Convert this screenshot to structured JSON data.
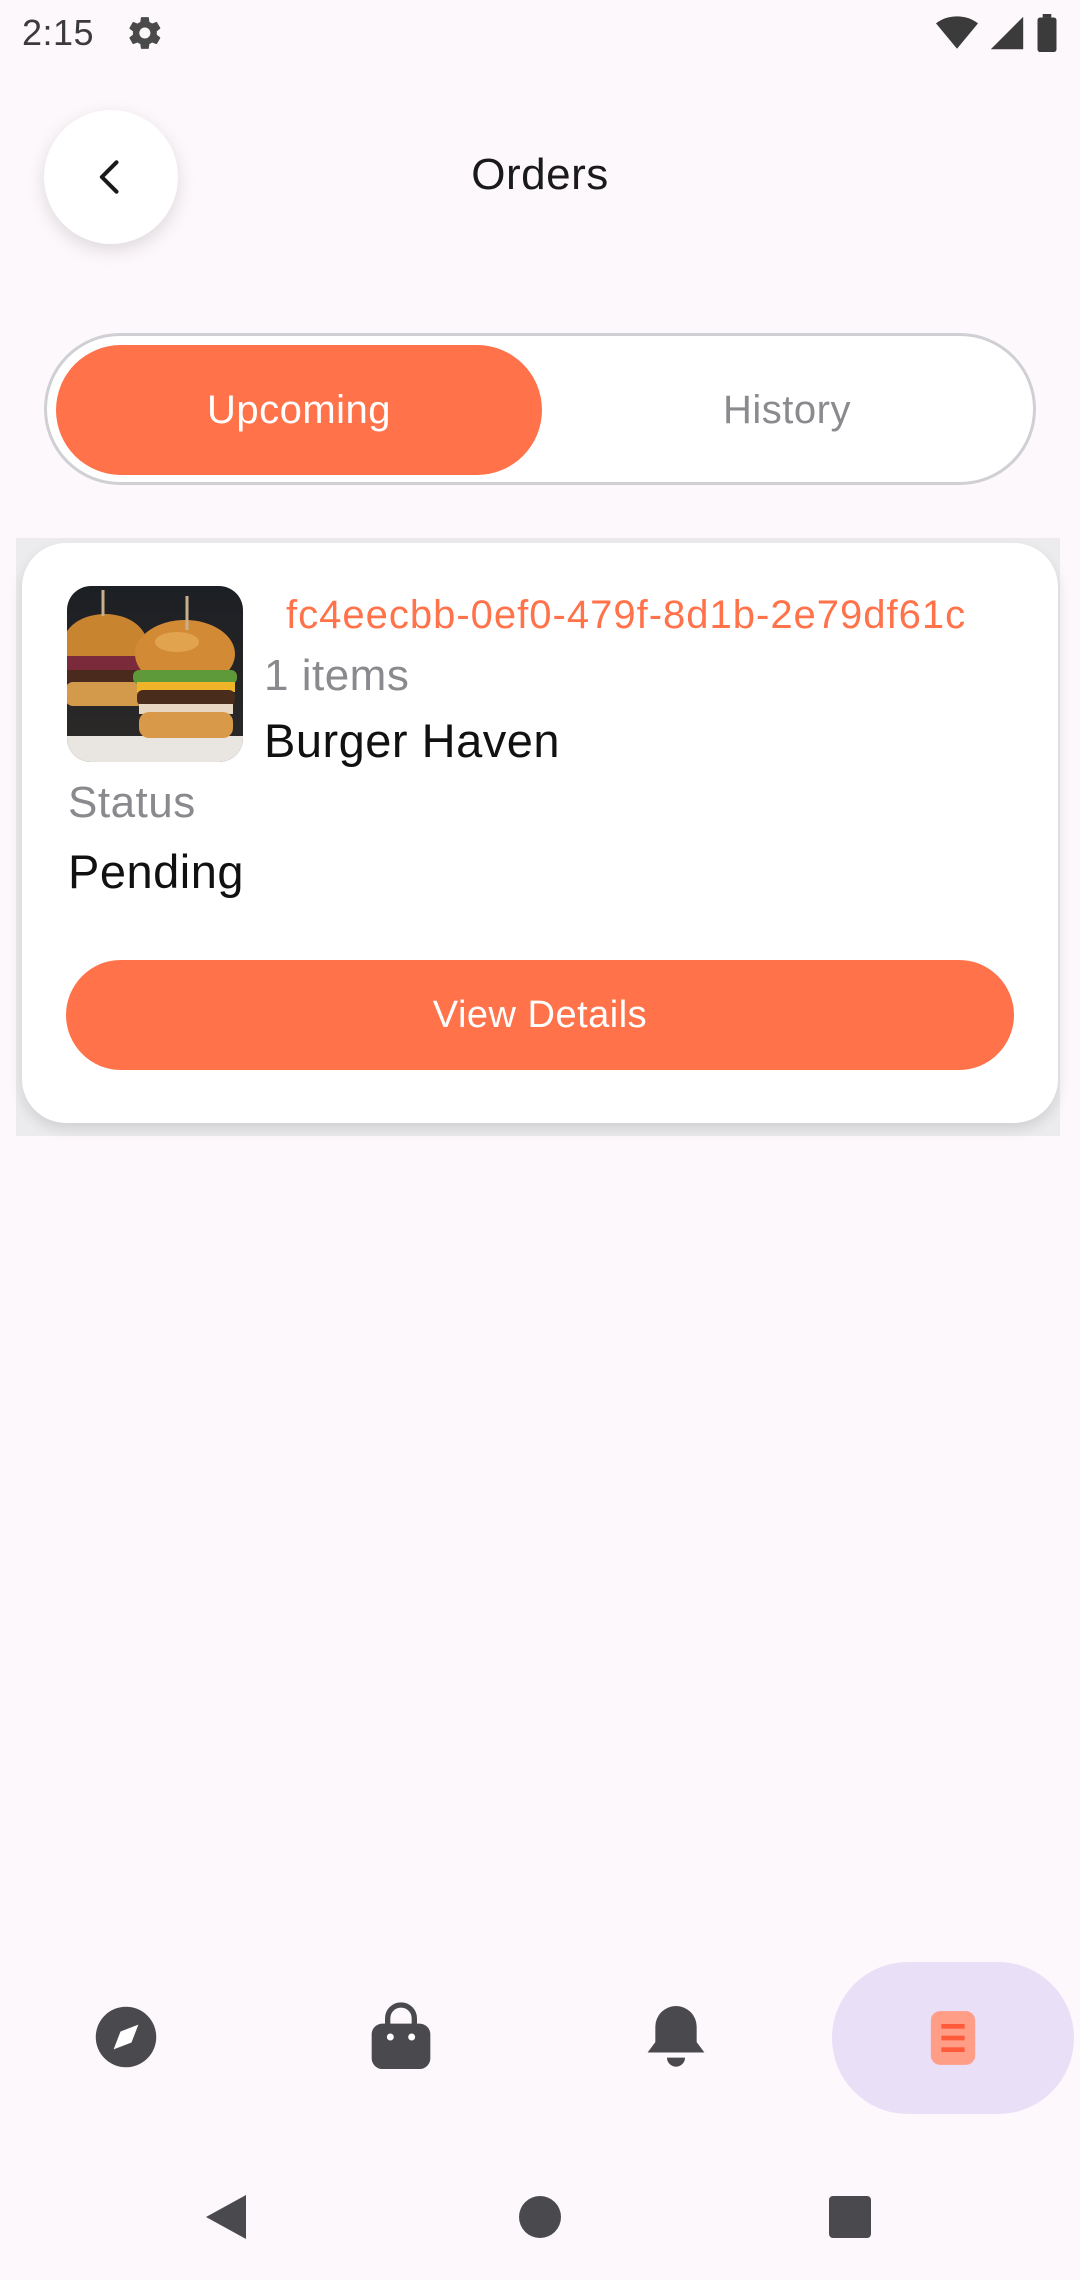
{
  "status_bar": {
    "time": "2:15"
  },
  "header": {
    "title": "Orders"
  },
  "tabs": [
    {
      "label": "Upcoming",
      "selected": true
    },
    {
      "label": "History",
      "selected": false
    }
  ],
  "orders": [
    {
      "id": "fc4eecbb-0ef0-479f-8d1b-2e79df61c",
      "items": "1 items",
      "restaurant": "Burger Haven",
      "status_label": "Status",
      "status": "Pending",
      "action_label": "View Details"
    }
  ],
  "bottom_nav": {
    "items": [
      {
        "icon": "compass-icon",
        "selected": false
      },
      {
        "icon": "shopping-bag-icon",
        "selected": false
      },
      {
        "icon": "bell-icon",
        "selected": false
      },
      {
        "icon": "orders-list-icon",
        "selected": true
      }
    ]
  },
  "colors": {
    "accent": "#ff724a",
    "background": "#fdf8fc",
    "nav_selected": "#e9dff7",
    "muted_text": "#8a8a8e"
  }
}
